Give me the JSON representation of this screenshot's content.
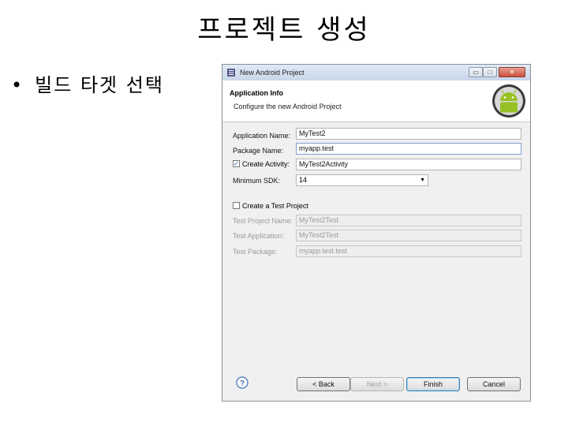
{
  "slide": {
    "title": "프로젝트 생성",
    "bullet_symbol": "•",
    "bullet_text": "빌드 타겟 선택"
  },
  "dialog": {
    "window_title": "New Android Project",
    "titlebar_buttons": {
      "minimize": "▭",
      "maximize": "□",
      "close": "✕"
    },
    "header_title": "Application Info",
    "header_subtitle": "Configure the new Android Project",
    "logo_icon": "android-logo-icon",
    "fields": {
      "application_name": {
        "label": "Application Name:",
        "value": "MyTest2"
      },
      "package_name": {
        "label": "Package Name:",
        "value": "myapp.test"
      },
      "create_activity": {
        "label": "Create Activity:",
        "checked": true,
        "value": "MyTest2Activity"
      },
      "minimum_sdk": {
        "label": "Minimum SDK:",
        "value": "14"
      }
    },
    "test_project": {
      "label": "Create a Test Project",
      "checked": false,
      "project_name": {
        "label": "Test Project Name:",
        "value": "MyTest2Test"
      },
      "application": {
        "label": "Test Application:",
        "value": "MyTest2Test"
      },
      "package": {
        "label": "Test Package:",
        "value": "myapp.test.test"
      }
    },
    "buttons": {
      "back": "< Back",
      "next": "Next >",
      "finish": "Finish",
      "cancel": "Cancel"
    },
    "help_icon": "help-icon",
    "checkmark": "✓"
  },
  "colors": {
    "titlebar": "#c9d7ea",
    "android_green": "#97c024",
    "help_blue": "#3a6fb7"
  }
}
